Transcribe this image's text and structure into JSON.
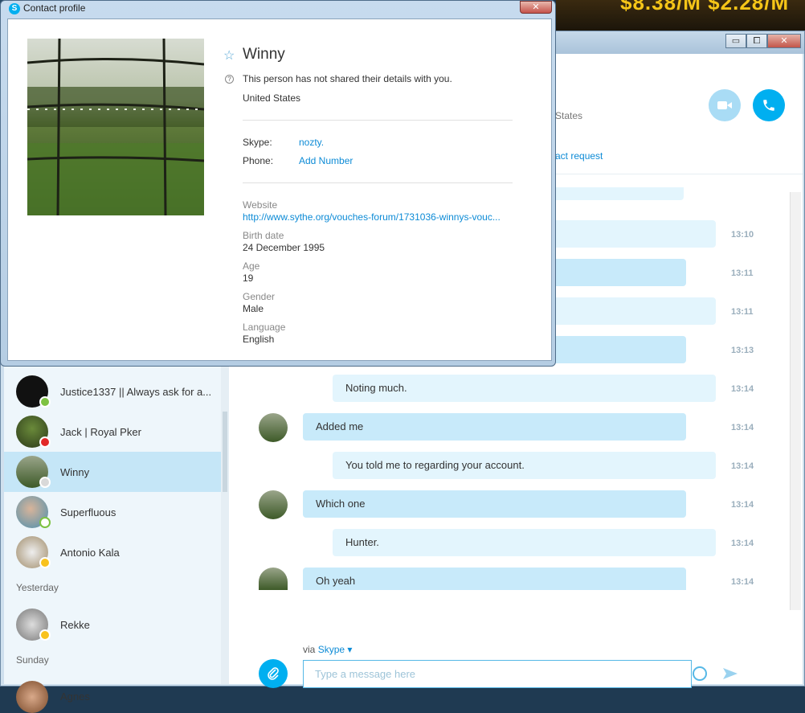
{
  "ad": {
    "text": "$8.38/M  $2.28/M"
  },
  "window": {
    "minimize": "▭",
    "maximize": "⧠",
    "close": "✕"
  },
  "sidebar": {
    "contacts": [
      {
        "name": "Justice1337 || Always ask for a...",
        "status": "online"
      },
      {
        "name": "Jack | Royal Pker",
        "status": "busy"
      },
      {
        "name": "Winny",
        "status": "unknown",
        "active": true
      },
      {
        "name": "Superfluous",
        "status": "offline"
      },
      {
        "name": "Antonio Kala",
        "status": "away"
      }
    ],
    "yesterday_label": "Yesterday",
    "yesterday": [
      {
        "name": "Rekke",
        "status": "away"
      }
    ],
    "sunday_label": "Sunday",
    "sunday": [
      {
        "name": "Agnes",
        "status": "unknown"
      }
    ]
  },
  "chat": {
    "header_location_partial": "d States",
    "contact_request_partial": "ntact request",
    "messages": [
      {
        "text": "",
        "time": "13:10",
        "dir": "out"
      },
      {
        "text": "",
        "time": "13:11",
        "dir": "in"
      },
      {
        "text": "",
        "time": "13:11",
        "dir": "out"
      },
      {
        "text": "",
        "time": "13:13",
        "dir": "in"
      },
      {
        "text": "Noting much.",
        "time": "13:14",
        "dir": "out"
      },
      {
        "text": "Added me",
        "time": "13:14",
        "dir": "in"
      },
      {
        "text": "You told me to regarding your account.",
        "time": "13:14",
        "dir": "out"
      },
      {
        "text": "Which one",
        "time": "13:14",
        "dir": "in"
      },
      {
        "text": "Hunter.",
        "time": "13:14",
        "dir": "out"
      },
      {
        "text": "Oh yeah",
        "time": "13:14",
        "dir": "in"
      }
    ],
    "via_label": "via",
    "via_service": "Skype ▾",
    "input_placeholder": "Type a message here"
  },
  "profile": {
    "window_title": "Contact profile",
    "close": "✕",
    "name": "Winny",
    "notice": "This person has not shared their details with you.",
    "country": "United States",
    "skype_label": "Skype:",
    "skype_value": "nozty.",
    "phone_label": "Phone:",
    "phone_value": "Add Number",
    "website_label": "Website",
    "website_value": "http://www.sythe.org/vouches-forum/1731036-winnys-vouc...",
    "birth_label": "Birth date",
    "birth_value": "24 December 1995",
    "age_label": "Age",
    "age_value": "19",
    "gender_label": "Gender",
    "gender_value": "Male",
    "language_label": "Language",
    "language_value": "English"
  },
  "colors": {
    "accent": "#00aff0",
    "link": "#0d8bd6",
    "active_row": "#c5e6f7"
  }
}
